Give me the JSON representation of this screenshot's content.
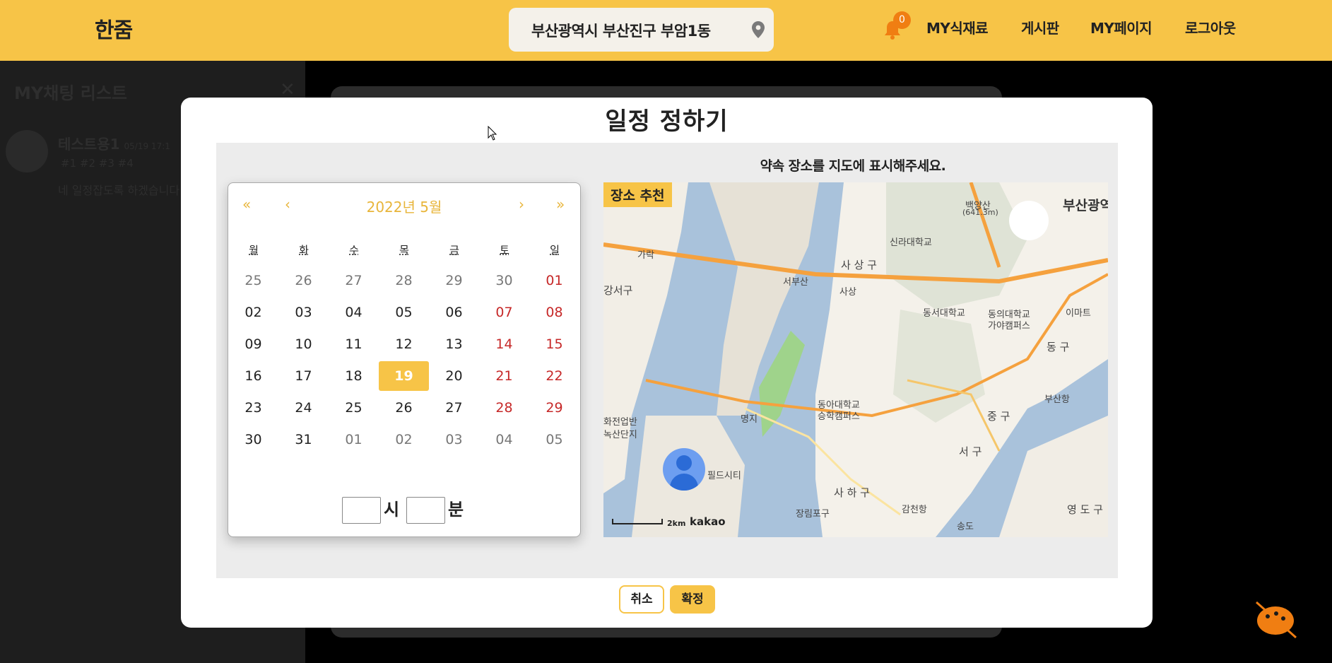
{
  "header": {
    "logo": "한줌",
    "location": "부산광역시 부산진구 부암1동",
    "notification_count": "0",
    "nav": [
      "MY식재료",
      "게시판",
      "MY페이지",
      "로그아웃"
    ]
  },
  "chat_panel": {
    "title": "MY채팅 리스트",
    "close": "✕",
    "item": {
      "name": "테스트용1",
      "time": "05/19 17:1",
      "sub": "#1 #2 #3 #4",
      "message": "네 일정잡도록 하겠습니다"
    }
  },
  "modal": {
    "title": "일정 정하기",
    "calendar": {
      "prev_year": "«",
      "prev_month": "‹",
      "month_label": "2022년 5월",
      "next_month": "›",
      "next_year": "»",
      "weekdays": [
        "월",
        "화",
        "수",
        "목",
        "금",
        "토",
        "일"
      ],
      "weeks": [
        [
          "25",
          "26",
          "27",
          "28",
          "29",
          "30",
          "01"
        ],
        [
          "02",
          "03",
          "04",
          "05",
          "06",
          "07",
          "08"
        ],
        [
          "09",
          "10",
          "11",
          "12",
          "13",
          "14",
          "15"
        ],
        [
          "16",
          "17",
          "18",
          "19",
          "20",
          "21",
          "22"
        ],
        [
          "23",
          "24",
          "25",
          "26",
          "27",
          "28",
          "29"
        ],
        [
          "30",
          "31",
          "01",
          "02",
          "03",
          "04",
          "05"
        ]
      ],
      "selected_day": "19",
      "hour_label": "시",
      "minute_label": "분",
      "hour_value": "",
      "minute_value": ""
    },
    "map": {
      "caption": "약속 장소를 지도에 표시해주세요.",
      "badge": "장소 추천",
      "labels": [
        "백양산",
        "(641.3m)",
        "부산광역",
        "신라대학교",
        "사 상 구",
        "서부산",
        "사상",
        "동서대학교",
        "동의대학교",
        "가야캠퍼스",
        "이마트",
        "동 구",
        "가락",
        "강서구",
        "명지",
        "동아대학교",
        "승학캠퍼스",
        "중 구",
        "부산항",
        "서 구",
        "필드시티",
        "사 하 구",
        "장림포구",
        "감천항",
        "송도",
        "영 도 구",
        "녹산단지",
        "화전업반"
      ],
      "scale_text": "2km",
      "provider": "kakao"
    },
    "cancel_label": "취소",
    "confirm_label": "확정"
  },
  "colors": {
    "brand": "#f7c447",
    "badge": "#f07e12",
    "weekend": "#c62828"
  }
}
